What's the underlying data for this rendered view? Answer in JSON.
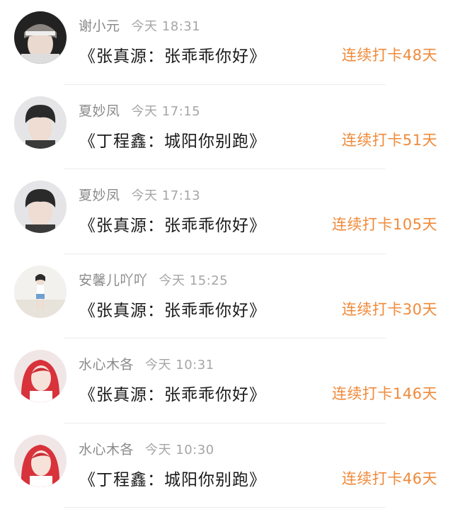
{
  "colors": {
    "accent": "#f08a3a",
    "username": "#8a8a8a",
    "timestamp": "#a6a6a6",
    "title": "#1a1a1a",
    "divider": "#ececec"
  },
  "entries": [
    {
      "username": "谢小元",
      "time": "今天 18:31",
      "title": "《张真源：张乖乖你好》",
      "streak": "连续打卡48天",
      "avatar": "avatar-photo-boy-headband"
    },
    {
      "username": "夏妙凤",
      "time": "今天 17:15",
      "title": "《丁程鑫：城阳你别跑》",
      "streak": "连续打卡51天",
      "avatar": "avatar-photo-boy-bangs"
    },
    {
      "username": "夏妙凤",
      "time": "今天 17:13",
      "title": "《张真源：张乖乖你好》",
      "streak": "连续打卡105天",
      "avatar": "avatar-photo-boy-bangs"
    },
    {
      "username": "安馨儿吖吖",
      "time": "今天 15:25",
      "title": "《张真源：张乖乖你好》",
      "streak": "连续打卡30天",
      "avatar": "avatar-photo-girl-standing"
    },
    {
      "username": "水心木各",
      "time": "今天 10:31",
      "title": "《张真源：张乖乖你好》",
      "streak": "连续打卡146天",
      "avatar": "avatar-photo-red-hair"
    },
    {
      "username": "水心木各",
      "time": "今天 10:30",
      "title": "《丁程鑫：城阳你别跑》",
      "streak": "连续打卡46天",
      "avatar": "avatar-photo-red-hair"
    }
  ]
}
